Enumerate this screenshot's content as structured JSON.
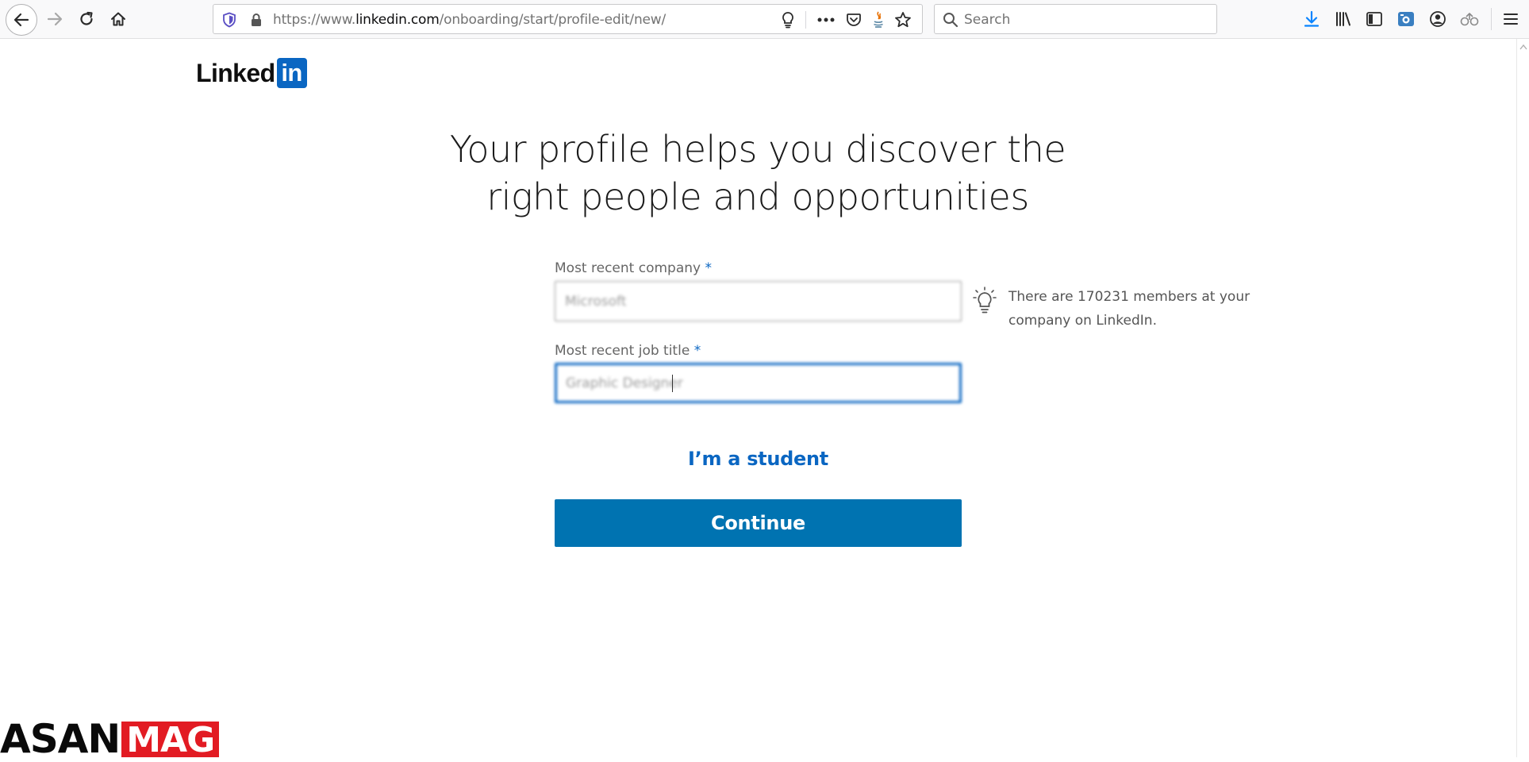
{
  "browser": {
    "url_prefix": "https://www.",
    "url_host": "linkedin.com",
    "url_path": "/onboarding/start/profile-edit/new/",
    "search_placeholder": "Search",
    "accent_color": "#0a84ff"
  },
  "page": {
    "logo_text": "Linked",
    "logo_badge": "in",
    "headline_line1": "Your profile helps you discover the",
    "headline_line2": "right people and opportunities",
    "company_label": "Most recent company",
    "company_value": "Microsoft",
    "job_title_label": "Most recent job title",
    "job_title_value": "Graphic Designer",
    "required_marker": "*",
    "hint_text": "There are 170231 members at your company on LinkedIn.",
    "student_link": "I’m a student",
    "continue_label": "Continue",
    "brand_color": "#0a66c2",
    "button_color": "#0073b1"
  },
  "watermark": {
    "part1": "ASAN",
    "part2": "MAG"
  }
}
